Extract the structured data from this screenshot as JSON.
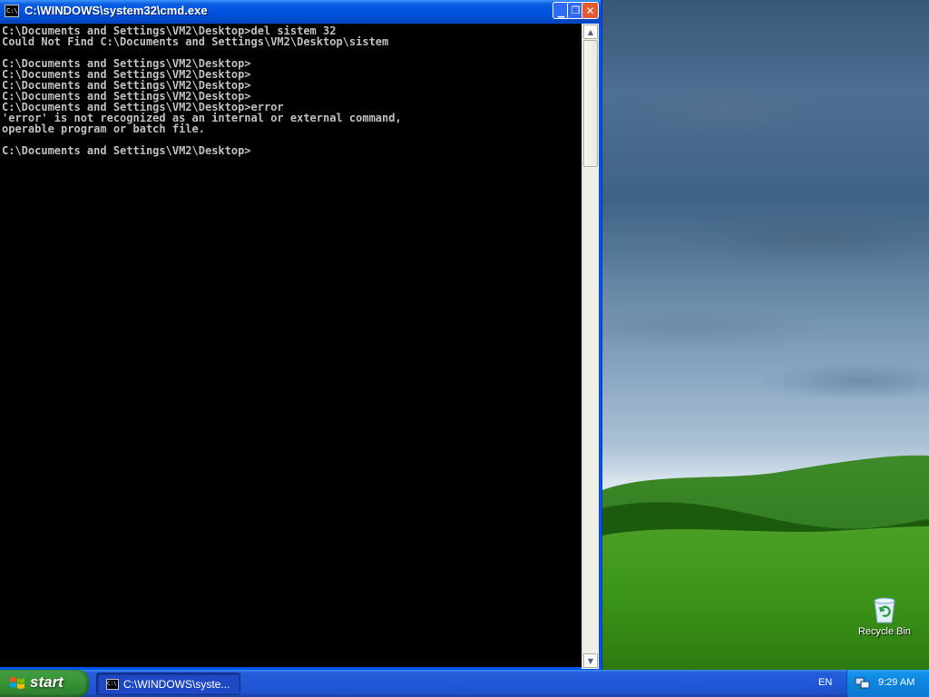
{
  "window": {
    "title": "C:\\WINDOWS\\system32\\cmd.exe",
    "icon_text": "C:\\",
    "console_lines": [
      "C:\\Documents and Settings\\VM2\\Desktop>del sistem 32",
      "Could Not Find C:\\Documents and Settings\\VM2\\Desktop\\sistem",
      "",
      "C:\\Documents and Settings\\VM2\\Desktop>",
      "C:\\Documents and Settings\\VM2\\Desktop>",
      "C:\\Documents and Settings\\VM2\\Desktop>",
      "C:\\Documents and Settings\\VM2\\Desktop>",
      "C:\\Documents and Settings\\VM2\\Desktop>error",
      "'error' is not recognized as an internal or external command,",
      "operable program or batch file.",
      "",
      "C:\\Documents and Settings\\VM2\\Desktop>"
    ],
    "buttons": {
      "minimize_icon": "minimize-icon",
      "maximize_icon": "restore-icon",
      "close_icon": "close-icon"
    }
  },
  "desktop": {
    "icons": [
      {
        "label": "Recycle Bin",
        "icon": "recycle-bin-icon"
      }
    ]
  },
  "taskbar": {
    "start_label": "start",
    "tasks": [
      {
        "label": "C:\\WINDOWS\\syste...",
        "icon": "cmd-icon"
      }
    ],
    "language": "EN",
    "clock": "9:29 AM"
  },
  "colors": {
    "titlebar": "#0054e3",
    "console_bg": "#000000",
    "console_fg": "#c0c0c0",
    "start_green": "#379237",
    "taskbar_blue": "#2157d6"
  }
}
